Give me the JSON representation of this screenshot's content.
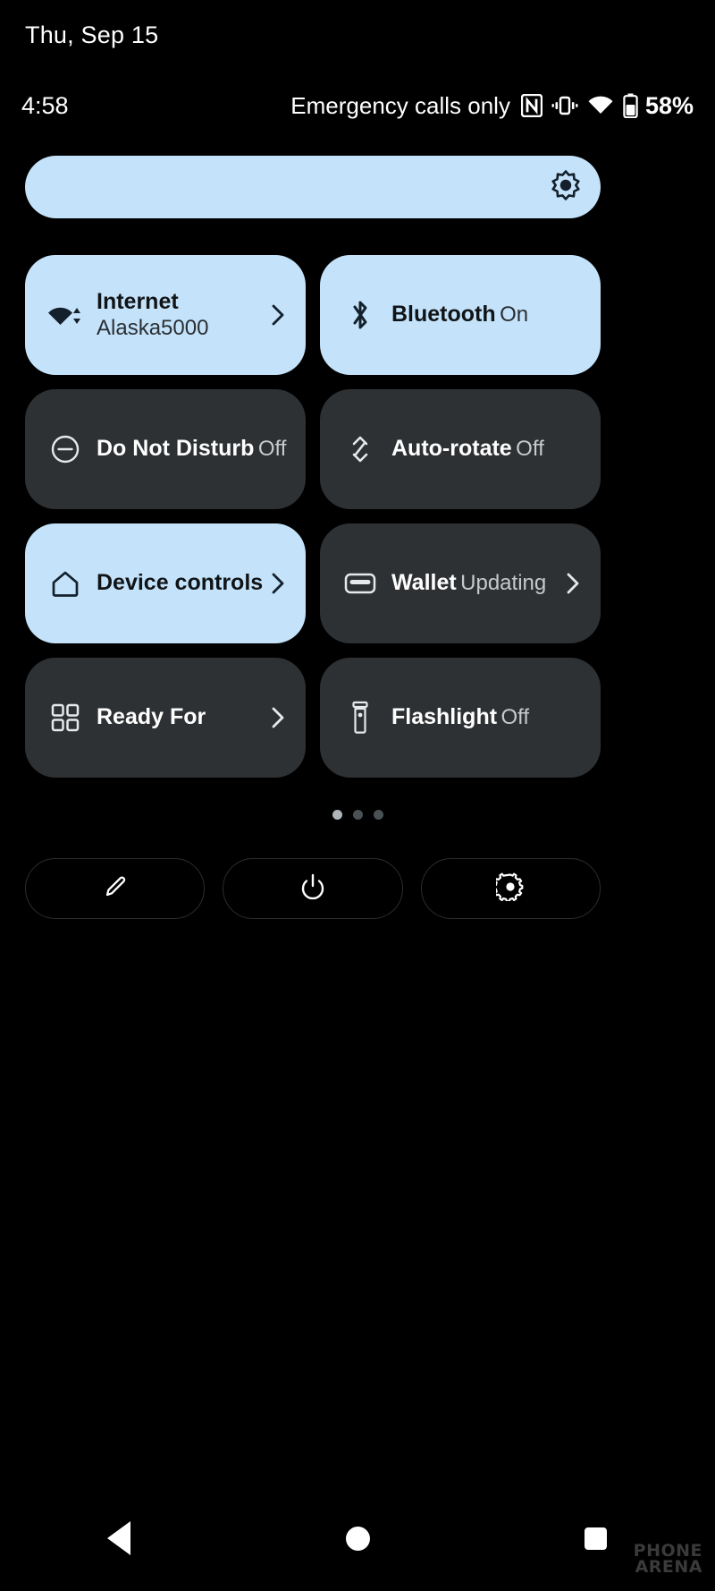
{
  "status": {
    "date": "Thu, Sep 15",
    "clock": "4:58",
    "carrier": "Emergency calls only",
    "battery_pct": "58%",
    "icons": [
      "nfc-icon",
      "vibrate-icon",
      "wifi-icon",
      "battery-icon"
    ]
  },
  "brightness": {
    "icon": "brightness-icon",
    "level": 100
  },
  "tiles": [
    {
      "title": "Internet",
      "sub": "Alaska5000",
      "icon": "wifi-data-icon",
      "active": true,
      "chevron": true
    },
    {
      "title": "Bluetooth",
      "sub": "On",
      "icon": "bluetooth-icon",
      "active": true,
      "chevron": false
    },
    {
      "title": "Do Not Disturb",
      "sub": "Off",
      "icon": "do-not-disturb-icon",
      "active": false,
      "chevron": false
    },
    {
      "title": "Auto-rotate",
      "sub": "Off",
      "icon": "auto-rotate-icon",
      "active": false,
      "chevron": false
    },
    {
      "title": "Device controls",
      "sub": "",
      "icon": "home-icon",
      "active": true,
      "chevron": true
    },
    {
      "title": "Wallet",
      "sub": "Updating",
      "icon": "wallet-icon",
      "active": false,
      "chevron": true
    },
    {
      "title": "Ready For",
      "sub": "",
      "icon": "grid-squares-icon",
      "active": false,
      "chevron": true
    },
    {
      "title": "Flashlight",
      "sub": "Off",
      "icon": "flashlight-icon",
      "active": false,
      "chevron": false
    }
  ],
  "pages": {
    "count": 3,
    "current": 1
  },
  "footer_actions": [
    {
      "icon": "pencil-icon",
      "name": "edit-tiles-button"
    },
    {
      "icon": "power-icon",
      "name": "power-button"
    },
    {
      "icon": "gear-icon",
      "name": "settings-button"
    }
  ],
  "navbar": [
    {
      "icon": "back-icon",
      "name": "nav-back-button"
    },
    {
      "icon": "home-icon",
      "name": "nav-home-button"
    },
    {
      "icon": "recents-icon",
      "name": "nav-recents-button"
    }
  ],
  "watermark": {
    "line1": "PHONE",
    "line2": "ARENA"
  },
  "colors": {
    "background": "#000000",
    "tile_active": "#c4e3fa",
    "tile_inactive": "#2e3133",
    "text_primary": "#ffffff",
    "text_secondary": "#c7c9cb",
    "text_on_active": "#111417"
  }
}
